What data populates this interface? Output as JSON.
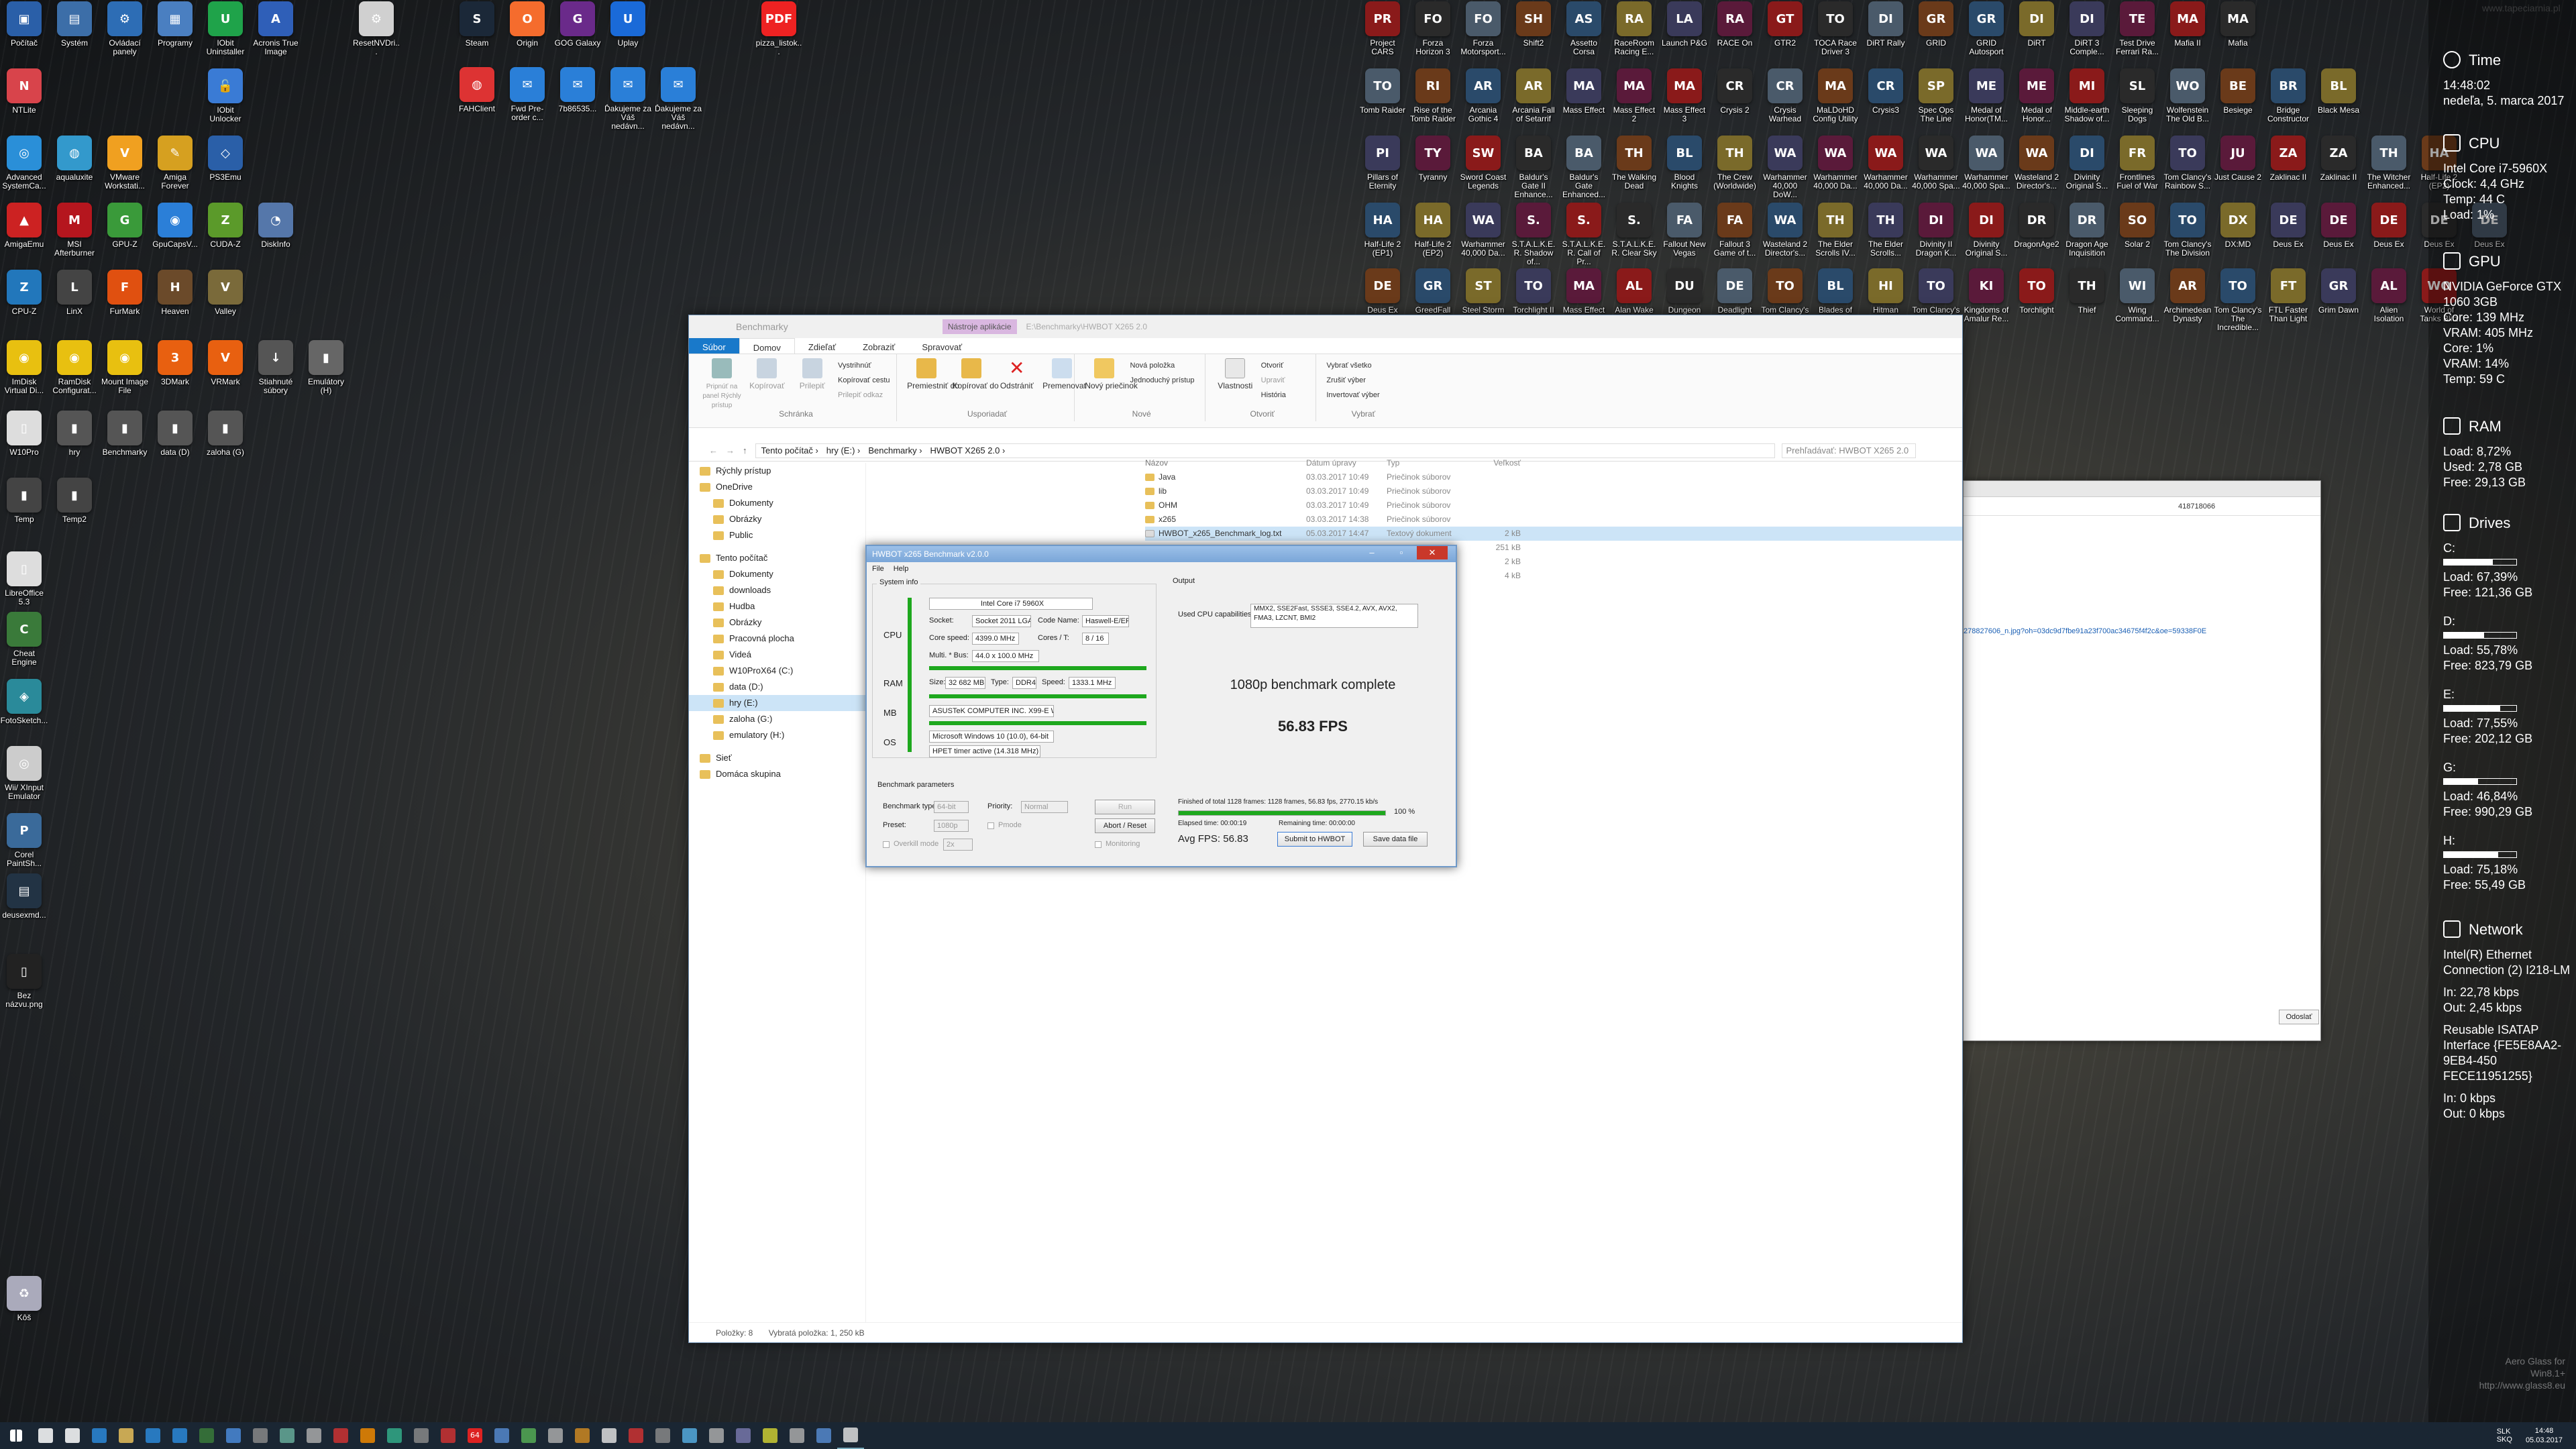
{
  "desktop_icons_left": [
    {
      "label": "Počítač",
      "color": "#2a5fa8",
      "glyph": "▣"
    },
    {
      "label": "Systém",
      "color": "#3c6ea8",
      "glyph": "▤"
    },
    {
      "label": "Ovládací panely",
      "color": "#2d6db5",
      "glyph": "⚙"
    },
    {
      "label": "Programy",
      "color": "#4a7fc1",
      "glyph": "▦"
    },
    {
      "label": "IObit Uninstaller",
      "color": "#1fa34a",
      "glyph": "U"
    },
    {
      "label": "Acronis True Image",
      "color": "#2f5fb8",
      "glyph": "A"
    },
    {
      "label": "ResetNVDri...",
      "color": "#d0d0d0",
      "glyph": "⚙"
    },
    {
      "label": "NTLite",
      "color": "#d8444b",
      "glyph": "N"
    },
    {
      "label": "IObit Unlocker",
      "color": "#3a7bd5",
      "glyph": "🔓"
    },
    {
      "label": "Advanced SystemCa...",
      "color": "#2a8fd8",
      "glyph": "◎"
    },
    {
      "label": "aqualuxite",
      "color": "#3399cc",
      "glyph": "◍"
    },
    {
      "label": "VMware Workstati...",
      "color": "#f0a020",
      "glyph": "V"
    },
    {
      "label": "Amiga Forever",
      "color": "#d6a020",
      "glyph": "✎"
    },
    {
      "label": "PS3Emu",
      "color": "#2a5fa8",
      "glyph": "◇"
    },
    {
      "label": "AmigaEmu",
      "color": "#c22",
      "glyph": "▲"
    },
    {
      "label": "MSI Afterburner",
      "color": "#b5161e",
      "glyph": "M"
    },
    {
      "label": "GPU-Z",
      "color": "#3a9a3a",
      "glyph": "G"
    },
    {
      "label": "GpuCapsV...",
      "color": "#2b7fd8",
      "glyph": "◉"
    },
    {
      "label": "CUDA-Z",
      "color": "#5b9a2a",
      "glyph": "Z"
    },
    {
      "label": "DiskInfo",
      "color": "#5577aa",
      "glyph": "◔"
    },
    {
      "label": "CPU-Z",
      "color": "#2277bb",
      "glyph": "Z"
    },
    {
      "label": "LinX",
      "color": "#444",
      "glyph": "L"
    },
    {
      "label": "FurMark",
      "color": "#e05010",
      "glyph": "F"
    },
    {
      "label": "Heaven",
      "color": "#6b4a2a",
      "glyph": "H"
    },
    {
      "label": "Valley",
      "color": "#7a6a3a",
      "glyph": "V"
    },
    {
      "label": "ImDisk Virtual Di...",
      "color": "#e8c010",
      "glyph": "◉"
    },
    {
      "label": "RamDisk Configurat...",
      "color": "#e8c010",
      "glyph": "◉"
    },
    {
      "label": "Mount Image File",
      "color": "#e8c010",
      "glyph": "◉"
    },
    {
      "label": "3DMark",
      "color": "#e86010",
      "glyph": "3"
    },
    {
      "label": "VRMark",
      "color": "#e86010",
      "glyph": "V"
    },
    {
      "label": "Stiahnuté súbory",
      "color": "#555",
      "glyph": "↓"
    },
    {
      "label": "Emulátory (H)",
      "color": "#666",
      "glyph": "▮"
    },
    {
      "label": "W10Pro",
      "color": "#dddddd",
      "glyph": "▯"
    },
    {
      "label": "hry",
      "color": "#555",
      "glyph": "▮"
    },
    {
      "label": "Benchmarky",
      "color": "#555",
      "glyph": "▮"
    },
    {
      "label": "data (D)",
      "color": "#555",
      "glyph": "▮"
    },
    {
      "label": "zaloha (G)",
      "color": "#555",
      "glyph": "▮"
    },
    {
      "label": "Temp",
      "color": "#444",
      "glyph": "▮"
    },
    {
      "label": "Temp2",
      "color": "#444",
      "glyph": "▮"
    },
    {
      "label": "LibreOffice 5.3",
      "color": "#dddddd",
      "glyph": "▯"
    },
    {
      "label": "Cheat Engine",
      "color": "#3a7a3a",
      "glyph": "C"
    },
    {
      "label": "FotoSketch...",
      "color": "#2a8a9a",
      "glyph": "◈"
    },
    {
      "label": "Wii/ XInput Emulator",
      "color": "#cccccc",
      "glyph": "◎"
    },
    {
      "label": "Corel PaintSh...",
      "color": "#3a6a9a",
      "glyph": "P"
    },
    {
      "label": "deusexmd...",
      "color": "#234",
      "glyph": "▤"
    },
    {
      "label": "Bez názvu.png",
      "color": "#222",
      "glyph": "▯"
    },
    {
      "label": "Kôš",
      "color": "#aab",
      "glyph": "♻"
    }
  ],
  "desktop_icons_top": [
    {
      "label": "Steam",
      "color": "#1b2838",
      "glyph": "S"
    },
    {
      "label": "Origin",
      "color": "#f56c2d",
      "glyph": "O"
    },
    {
      "label": "GOG Galaxy",
      "color": "#6a2a8a",
      "glyph": "G"
    },
    {
      "label": "Uplay",
      "color": "#1a6ad8",
      "glyph": "U"
    },
    {
      "label": "pizza_listok...",
      "color": "#e22",
      "glyph": "PDF"
    },
    {
      "label": "FAHClient",
      "color": "#d33",
      "glyph": "◍"
    },
    {
      "label": "Fwd Pre-order c...",
      "color": "#2a7fd8",
      "glyph": "✉"
    },
    {
      "label": "7b86535...",
      "color": "#2a7fd8",
      "glyph": "✉"
    },
    {
      "label": "Ďakujeme za Váš nedávn...",
      "color": "#2a7fd8",
      "glyph": "✉"
    },
    {
      "label": "Ďakujeme za Váš nedávn...",
      "color": "#2a7fd8",
      "glyph": "✉"
    }
  ],
  "game_icons": [
    "Project CARS",
    "Forza Horizon 3",
    "Forza Motorsport...",
    "Shift2",
    "Assetto Corsa",
    "RaceRoom Racing E...",
    "Launch P&G",
    "RACE On",
    "GTR2",
    "TOCA Race Driver 3",
    "DiRT Rally",
    "GRID",
    "GRID Autosport",
    "DiRT",
    "DiRT 3 Comple...",
    "Test Drive Ferrari Ra...",
    "Mafia II",
    "Mafia",
    "Tomb Raider",
    "Rise of the Tomb Raider",
    "Arcania Gothic 4",
    "Arcania Fall of Setarrif",
    "Mass Effect",
    "Mass Effect 2",
    "Mass Effect 3",
    "Crysis 2",
    "Crysis Warhead",
    "MaLDoHD Config Utility",
    "Crysis3",
    "Spec Ops The Line",
    "Medal of Honor(TM...",
    "Medal of Honor...",
    "Middle-earth Shadow of...",
    "Sleeping Dogs",
    "Wolfenstein The Old B...",
    "Besiege",
    "Bridge Constructor",
    "Black Mesa",
    "Pillars of Eternity",
    "Tyranny",
    "Sword Coast Legends",
    "Baldur's Gate II Enhance...",
    "Baldur's Gate Enhanced...",
    "The Walking Dead",
    "Blood Knights",
    "The Crew (Worldwide)",
    "Warhammer 40,000 DoW...",
    "Warhammer 40,000 Da...",
    "Warhammer 40,000 Da...",
    "Warhammer 40,000 Spa...",
    "Warhammer 40,000 Spa...",
    "Wasteland 2 Director's...",
    "Divinity Original S...",
    "Frontlines Fuel of War",
    "Tom Clancy's Rainbow S...",
    "Just Cause 2",
    "Zaklinac II",
    "Zaklinac II",
    "The Witcher Enhanced...",
    "Half-Life 2 (EP2)",
    "Half-Life 2 (EP1)",
    "Half-Life 2 (EP2)",
    "Warhammer 40,000 Da...",
    "S.T.A.L.K.E.R. Shadow of...",
    "S.T.A.L.K.E.R. Call of Pr...",
    "S.T.A.L.K.E.R. Clear Sky",
    "Fallout New Vegas",
    "Fallout 3 Game of t...",
    "Wasteland 2 Director's...",
    "The Elder Scrolls IV...",
    "The Elder Scrolls...",
    "Divinity II Dragon K...",
    "Divinity Original S...",
    "DragonAge2",
    "Dragon Age Inquisition",
    "Solar 2",
    "Tom Clancy's The Division",
    "DX:MD",
    "Deus Ex",
    "Deus Ex",
    "Deus Ex",
    "Deus Ex",
    "Deus Ex",
    "Deus Ex",
    "GreedFall",
    "Steel Storm",
    "Torchlight II",
    "Mass Effect",
    "Alan Wake",
    "Dungeon Siege III",
    "Deadlight",
    "Tom Clancy's Splinter Cel...",
    "Blades of Time",
    "Hitman Absolution",
    "Tom Clancy's Rainbow S...",
    "Kingdoms of Amalur Re...",
    "Torchlight",
    "Thief",
    "Wing Command...",
    "Archimedean Dynasty",
    "Tom Clancy's The Incredible...",
    "FTL Faster Than Light",
    "Grim Dawn",
    "Alien Isolation",
    "World of Tanks Blitz"
  ],
  "sidebar": {
    "time": {
      "title": "Time",
      "clock": "14:48:02",
      "date": "nedeľa, 5. marca 2017"
    },
    "cpu": {
      "title": "CPU",
      "model": "Intel Core i7-5960X",
      "clock": "Clock: 4,4 GHz",
      "temp": "Temp: 44 C",
      "load": "Load: 1%"
    },
    "gpu": {
      "title": "GPU",
      "model": "NVIDIA GeForce GTX 1060 3GB",
      "core_clock": "Core: 139 MHz",
      "vram_clock": "VRAM: 405 MHz",
      "core": "Core: 1%",
      "vram": "VRAM: 14%",
      "temp": "Temp: 59 C"
    },
    "ram": {
      "title": "RAM",
      "load": "Load: 8,72%",
      "used": "Used: 2,78 GB",
      "free": "Free: 29,13 GB"
    },
    "drives": {
      "title": "Drives",
      "items": [
        {
          "letter": "C:",
          "load": "Load: 67,39%",
          "free": "Free: 121,36 GB",
          "fill": 0.674
        },
        {
          "letter": "D:",
          "load": "Load: 55,78%",
          "free": "Free: 823,79 GB",
          "fill": 0.558
        },
        {
          "letter": "E:",
          "load": "Load: 77,55%",
          "free": "Free: 202,12 GB",
          "fill": 0.776
        },
        {
          "letter": "G:",
          "load": "Load: 46,84%",
          "free": "Free: 990,29 GB",
          "fill": 0.468
        },
        {
          "letter": "H:",
          "load": "Load: 75,18%",
          "free": "Free: 55,49 GB",
          "fill": 0.752
        }
      ]
    },
    "network": {
      "title": "Network",
      "adapter1": "Intel(R) Ethernet Connection (2) I218-LM",
      "in1": "In: 22,78 kbps",
      "out1": "Out: 2,45 kbps",
      "adapter2": "Reusable ISATAP Interface {FE5E8AA2-9EB4-450 FECE11951255}",
      "in2": "In: 0 kbps",
      "out2": "Out: 0 kbps"
    }
  },
  "explorer": {
    "title": "Benchmarky",
    "contextual_tab": "Nástroje aplikácie",
    "path_title": "E:\\Benchmarky\\HWBOT X265 2.0",
    "tabs": [
      "Súbor",
      "Domov",
      "Zdieľať",
      "Zobraziť",
      "Spravovať"
    ],
    "ribbon": {
      "clipboard": {
        "name": "Schránka",
        "pin": "Pripnúť na panel Rýchly prístup",
        "copy": "Kopírovať",
        "paste": "Prilepiť",
        "cut": "Vystrihnúť",
        "copy_path": "Kopírovať cestu",
        "paste_shortcut": "Prilepiť odkaz"
      },
      "organize": {
        "name": "Usporiadať",
        "move": "Premiestniť do",
        "copyto": "Kopírovať do",
        "delete": "Odstrániť",
        "rename": "Premenovať"
      },
      "new": {
        "name": "Nové",
        "folder": "Nový priečinok",
        "new_item": "Nová položka",
        "easy_access": "Jednoduchý prístup"
      },
      "open": {
        "name": "Otvoriť",
        "properties": "Vlastnosti",
        "open": "Otvoriť",
        "edit": "Upraviť",
        "history": "História"
      },
      "select": {
        "name": "Vybrať",
        "all": "Vybrať všetko",
        "none": "Zrušiť výber",
        "invert": "Invertovať výber"
      }
    },
    "breadcrumb": [
      "Tento počítač",
      "hry (E:)",
      "Benchmarky",
      "HWBOT X265 2.0"
    ],
    "search_placeholder": "Prehľadávať: HWBOT X265 2.0",
    "nav": [
      {
        "label": "Rýchly prístup",
        "sel": false,
        "indent": 0
      },
      {
        "label": "OneDrive",
        "sel": false,
        "indent": 0
      },
      {
        "label": "Dokumenty",
        "sel": false,
        "indent": 1
      },
      {
        "label": "Obrázky",
        "sel": false,
        "indent": 1
      },
      {
        "label": "Public",
        "sel": false,
        "indent": 1
      },
      {
        "label": "Tento počítač",
        "sel": false,
        "indent": 0
      },
      {
        "label": "Dokumenty",
        "sel": false,
        "indent": 1
      },
      {
        "label": "downloads",
        "sel": false,
        "indent": 1
      },
      {
        "label": "Hudba",
        "sel": false,
        "indent": 1
      },
      {
        "label": "Obrázky",
        "sel": false,
        "indent": 1
      },
      {
        "label": "Pracovná plocha",
        "sel": false,
        "indent": 1
      },
      {
        "label": "Videá",
        "sel": false,
        "indent": 1
      },
      {
        "label": "W10ProX64 (C:)",
        "sel": false,
        "indent": 1
      },
      {
        "label": "data (D:)",
        "sel": false,
        "indent": 1
      },
      {
        "label": "hry (E:)",
        "sel": true,
        "indent": 1
      },
      {
        "label": "zaloha (G:)",
        "sel": false,
        "indent": 1
      },
      {
        "label": "emulatory (H:)",
        "sel": false,
        "indent": 1
      },
      {
        "label": "Sieť",
        "sel": false,
        "indent": 0
      },
      {
        "label": "Domáca skupina",
        "sel": false,
        "indent": 0
      }
    ],
    "columns": [
      "Názov",
      "Dátum úpravy",
      "Typ",
      "Veľkosť"
    ],
    "files": [
      {
        "name": "Java",
        "date": "03.03.2017 10:49",
        "type": "Priečinok súborov",
        "size": ""
      },
      {
        "name": "lib",
        "date": "03.03.2017 10:49",
        "type": "Priečinok súborov",
        "size": ""
      },
      {
        "name": "OHM",
        "date": "03.03.2017 10:49",
        "type": "Priečinok súborov",
        "size": ""
      },
      {
        "name": "x265",
        "date": "03.03.2017 14:38",
        "type": "Priečinok súborov",
        "size": ""
      },
      {
        "name": "HWBOT_x265_Benchmark_log.txt",
        "date": "05.03.2017 14:47",
        "type": "Textový dokument",
        "size": "2 kB"
      },
      {
        "name": "",
        "date": "",
        "type": "",
        "size": "251 kB"
      },
      {
        "name": "",
        "date": "",
        "type": "ent",
        "size": "2 kB"
      },
      {
        "name": "",
        "date": "",
        "type": "ent",
        "size": "4 kB"
      }
    ],
    "status_count": "Položky: 8",
    "status_sel": "Vybratá položka: 1, 250 kB"
  },
  "browser": {
    "tab_label": "418718066",
    "link": "278827606_n.jpg?oh=03dc9d7fbe91a23f700ac34675f4f2c&oe=59338F0E",
    "download_label": "Odoslať"
  },
  "hwbot": {
    "title": "HWBOT x265 Benchmark v2.0.0",
    "menu": [
      "File",
      "Help"
    ],
    "system_info_label": "System info",
    "cpu_label": "CPU",
    "ram_label": "RAM",
    "mb_label": "MB",
    "os_label": "OS",
    "cpu_name": "Intel Core i7 5960X",
    "socket_label": "Socket:",
    "socket": "Socket 2011 LGA",
    "codename_label": "Code Name:",
    "codename": "Haswell-E/EP",
    "corespeed_label": "Core speed:",
    "corespeed": "4399.0 MHz",
    "cores_label": "Cores / T:",
    "cores": "8 / 16",
    "multi_label": "Multi. * Bus:",
    "multi": "44.0 x 100.0 MHz",
    "ram_size_label": "Size:",
    "ram_size": "32 682 MB",
    "ram_type_label": "Type:",
    "ram_type": "DDR4",
    "ram_speed_label": "Speed:",
    "ram_speed": "1333.1 MHz",
    "mb_name": "ASUSTeK COMPUTER INC. X99-E WS",
    "os_name": "Microsoft Windows 10 (10.0), 64-bit",
    "timer": "HPET timer active (14.318 MHz)",
    "params_label": "Benchmark parameters",
    "bench_type_label": "Benchmark type:",
    "bench_type": "64-bit",
    "priority_label": "Priority:",
    "priority": "Normal",
    "run_label": "Run",
    "preset_label": "Preset:",
    "preset": "1080p",
    "pmode_label": "Pmode",
    "abort_label": "Abort / Reset",
    "overkill_label": "Overkill mode",
    "overkill": "2x",
    "monitoring_label": "Monitoring",
    "output_label": "Output",
    "capabilities_label": "Used CPU capabilities:",
    "capabilities": "MMX2, SSE2Fast, SSSE3, SSE4.2, AVX, AVX2, FMA3, LZCNT, BMI2",
    "complete": "1080p benchmark complete",
    "fps": "56.83 FPS",
    "finished": "Finished of total 1128 frames: 1128 frames, 56.83 fps,   2770.15 kb/s",
    "progress_pct": "100 %",
    "progress": 1.0,
    "elapsed": "Elapsed time: 00:00:19",
    "remaining": "Remaining time: 00:00:00",
    "avg": "Avg FPS: 56.83",
    "submit_label": "Submit to HWBOT",
    "save_label": "Save data file"
  },
  "watermark": {
    "line1": "Aero Glass for Win8.1+",
    "line2": "http://www.glass8.eu"
  },
  "site_watermark": "www.tapeciarnia.pl",
  "taskbar": {
    "lang": "SLK\nSKQ",
    "time": "14:48",
    "date": "05.03.2017",
    "icons": [
      "start",
      "search",
      "task-view",
      "edge",
      "explorer",
      "store",
      "mail",
      "app",
      "app",
      "app",
      "app",
      "app",
      "app",
      "app",
      "app",
      "app",
      "app",
      "64",
      "app",
      "app",
      "app",
      "app",
      "app",
      "app",
      "app",
      "app",
      "app",
      "app",
      "app",
      "app",
      "app",
      "app"
    ]
  }
}
